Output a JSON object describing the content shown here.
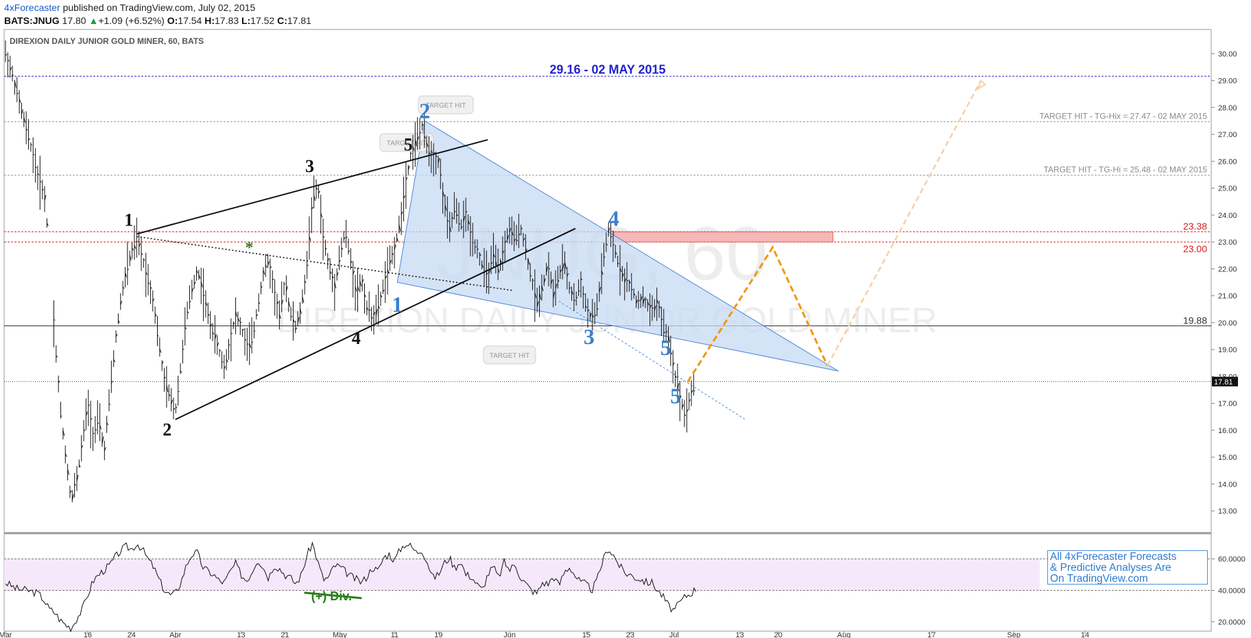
{
  "header": {
    "author": "4xForecaster",
    "published": "published on TradingView.com, July 02, 2015",
    "symbol": "BATS:JNUG",
    "last": "17.80",
    "change_arrow": "▲",
    "change": "+1.09 (+6.52%)",
    "o_label": "O:",
    "o": "17.54",
    "h_label": "H:",
    "h": "17.83",
    "l_label": "L:",
    "l": "17.52",
    "c_label": "C:",
    "c": "17.81"
  },
  "chart_title": "DIREXION DAILY JUNIOR GOLD MINER, 60, BATS",
  "watermark": {
    "big": "JNUG, 60",
    "sub": "DIREXION DAILY JUNIOR GOLD MINER"
  },
  "chart_data": [
    {
      "type": "line",
      "name": "price",
      "x_ticks": [
        {
          "label": "Mar",
          "day": 0
        },
        {
          "label": "16",
          "day": 15
        },
        {
          "label": "24",
          "day": 23
        },
        {
          "label": "Apr",
          "day": 31
        },
        {
          "label": "13",
          "day": 43
        },
        {
          "label": "21",
          "day": 51
        },
        {
          "label": "May",
          "day": 61
        },
        {
          "label": "11",
          "day": 71
        },
        {
          "label": "19",
          "day": 79
        },
        {
          "label": "Jun",
          "day": 92
        },
        {
          "label": "15",
          "day": 106
        },
        {
          "label": "23",
          "day": 114
        },
        {
          "label": "Jul",
          "day": 122
        },
        {
          "label": "13",
          "day": 134
        },
        {
          "label": "20",
          "day": 141
        },
        {
          "label": "Aug",
          "day": 153
        },
        {
          "label": "17",
          "day": 169
        },
        {
          "label": "Sep",
          "day": 184
        },
        {
          "label": "14",
          "day": 197
        }
      ],
      "ylim": [
        12.2,
        30.9
      ],
      "y_ticks": [
        "13.00",
        "14.00",
        "15.00",
        "16.00",
        "17.00",
        "18.00",
        "19.00",
        "20.00",
        "21.00",
        "22.00",
        "23.00",
        "24.00",
        "25.00",
        "26.00",
        "27.00",
        "28.00",
        "29.00",
        "30.00"
      ],
      "price_path": [
        [
          0,
          30.0
        ],
        [
          1,
          29.4
        ],
        [
          2,
          28.6
        ],
        [
          3,
          27.8
        ],
        [
          4,
          27.0
        ],
        [
          5,
          26.3
        ],
        [
          6,
          25.3
        ],
        [
          7,
          24.9
        ],
        [
          8,
          22.8
        ],
        [
          9,
          19.5
        ],
        [
          10,
          16.8
        ],
        [
          11,
          15.0
        ],
        [
          12,
          13.4
        ],
        [
          13,
          14.2
        ],
        [
          14,
          15.5
        ],
        [
          15,
          17.0
        ],
        [
          16,
          15.8
        ],
        [
          17,
          16.4
        ],
        [
          18,
          15.2
        ],
        [
          19,
          17.2
        ],
        [
          20,
          19.2
        ],
        [
          21,
          20.8
        ],
        [
          22,
          21.9
        ],
        [
          23,
          22.6
        ],
        [
          24,
          23.1
        ],
        [
          25,
          22.4
        ],
        [
          26,
          21.6
        ],
        [
          27,
          20.8
        ],
        [
          28,
          19.2
        ],
        [
          29,
          17.8
        ],
        [
          30,
          17.2
        ],
        [
          31,
          16.7
        ],
        [
          32,
          18.4
        ],
        [
          33,
          20.2
        ],
        [
          34,
          21.2
        ],
        [
          35,
          22.0
        ],
        [
          36,
          21.2
        ],
        [
          37,
          20.2
        ],
        [
          38,
          19.6
        ],
        [
          39,
          18.9
        ],
        [
          40,
          18.3
        ],
        [
          41,
          19.4
        ],
        [
          42,
          20.3
        ],
        [
          43,
          19.8
        ],
        [
          44,
          19.1
        ],
        [
          45,
          19.3
        ],
        [
          46,
          20.6
        ],
        [
          47,
          21.8
        ],
        [
          48,
          22.3
        ],
        [
          49,
          21.2
        ],
        [
          50,
          20.2
        ],
        [
          51,
          21.6
        ],
        [
          52,
          20.3
        ],
        [
          53,
          19.8
        ],
        [
          54,
          20.6
        ],
        [
          55,
          22.1
        ],
        [
          56,
          24.5
        ],
        [
          57,
          25.1
        ],
        [
          58,
          23.1
        ],
        [
          59,
          22.1
        ],
        [
          60,
          21.3
        ],
        [
          61,
          22.5
        ],
        [
          62,
          23.4
        ],
        [
          63,
          22.3
        ],
        [
          64,
          21.1
        ],
        [
          65,
          21.6
        ],
        [
          66,
          20.5
        ],
        [
          67,
          20.2
        ],
        [
          68,
          20.5
        ],
        [
          69,
          21.4
        ],
        [
          70,
          22.1
        ],
        [
          71,
          22.8
        ],
        [
          72,
          23.7
        ],
        [
          73,
          25.2
        ],
        [
          74,
          26.3
        ],
        [
          75,
          26.8
        ],
        [
          76,
          27.3
        ],
        [
          77,
          26.5
        ],
        [
          78,
          26.2
        ],
        [
          79,
          26.0
        ],
        [
          80,
          24.5
        ],
        [
          81,
          23.4
        ],
        [
          82,
          24.3
        ],
        [
          83,
          23.6
        ],
        [
          84,
          24.0
        ],
        [
          85,
          23.2
        ],
        [
          86,
          22.8
        ],
        [
          87,
          22.1
        ],
        [
          88,
          21.7
        ],
        [
          89,
          22.5
        ],
        [
          90,
          21.9
        ],
        [
          91,
          22.8
        ],
        [
          92,
          23.5
        ],
        [
          93,
          23.0
        ],
        [
          94,
          23.6
        ],
        [
          95,
          22.6
        ],
        [
          96,
          21.6
        ],
        [
          97,
          20.7
        ],
        [
          98,
          21.4
        ],
        [
          99,
          22.2
        ],
        [
          100,
          21.0
        ],
        [
          101,
          21.8
        ],
        [
          102,
          22.2
        ],
        [
          103,
          21.2
        ],
        [
          104,
          20.8
        ],
        [
          105,
          21.5
        ],
        [
          106,
          20.5
        ],
        [
          107,
          20.1
        ],
        [
          108,
          20.6
        ],
        [
          109,
          22.2
        ],
        [
          110,
          23.4
        ],
        [
          111,
          22.8
        ],
        [
          112,
          22.1
        ],
        [
          113,
          21.6
        ],
        [
          114,
          21.4
        ],
        [
          115,
          20.8
        ],
        [
          116,
          20.9
        ],
        [
          117,
          20.7
        ],
        [
          118,
          20.4
        ],
        [
          119,
          20.8
        ],
        [
          120,
          19.8
        ],
        [
          121,
          19.4
        ],
        [
          122,
          18.2
        ],
        [
          123,
          17.3
        ],
        [
          124,
          16.6
        ],
        [
          125,
          17.3
        ],
        [
          126,
          17.8
        ]
      ],
      "wave_labels_black": [
        {
          "t": "1",
          "day": 22.5,
          "price": 23.6
        },
        {
          "t": "2",
          "day": 29.5,
          "price": 15.8
        },
        {
          "t": "3",
          "day": 55.5,
          "price": 25.6
        },
        {
          "t": "4",
          "day": 64,
          "price": 19.2
        },
        {
          "t": "5",
          "day": 73.5,
          "price": 26.4
        },
        {
          "t": "*",
          "day": 44.5,
          "price": 22.6
        }
      ],
      "wave_labels_blue": [
        {
          "t": "2",
          "day": 76.5,
          "price": 27.6
        },
        {
          "t": "1",
          "day": 71.5,
          "price": 20.4
        },
        {
          "t": "4",
          "day": 111,
          "price": 23.6
        },
        {
          "t": "3",
          "day": 106.5,
          "price": 19.2
        },
        {
          "t": "5",
          "day": 120.5,
          "price": 18.8
        },
        {
          "t": "5",
          "day": 122.3,
          "price": 17.0
        }
      ],
      "levels": [
        {
          "price": 29.16,
          "color": "#2222cc",
          "label": "29.16 - 02 MAY 2015",
          "style": "dashed"
        },
        {
          "price": 27.47,
          "color": "#999999",
          "label": "TARGET HIT - TG-Hix = 27.47 - 02 MAY 2015",
          "style": "dashed"
        },
        {
          "price": 25.48,
          "color": "#999999",
          "label": "TARGET HIT - TG-Hi = 25.48 - 02 MAY 2015",
          "style": "dashed"
        },
        {
          "price": 23.38,
          "color": "#d62020",
          "label": "23.38",
          "style": "dashed"
        },
        {
          "price": 23.0,
          "color": "#d62020",
          "label": "23.00",
          "style": "dashed"
        },
        {
          "price": 19.88,
          "color": "#333333",
          "label": "19.88",
          "style": "solid"
        },
        {
          "price": 17.81,
          "color": "#333333",
          "label": "17.81",
          "style": "dotted"
        }
      ],
      "target_hit_label": "TARGET HIT"
    },
    {
      "type": "line",
      "name": "oscillator",
      "ylim": [
        14.0,
        76.0
      ],
      "y_ticks": [
        "20.0000",
        "40.0000",
        "60.0000"
      ],
      "upper_band": 60,
      "lower_band": 40,
      "annotation": "(+) Div.",
      "values": [
        [
          0,
          45
        ],
        [
          2,
          41
        ],
        [
          4,
          40
        ],
        [
          6,
          38
        ],
        [
          7,
          34
        ],
        [
          8,
          28
        ],
        [
          9,
          26
        ],
        [
          10,
          21
        ],
        [
          11,
          18
        ],
        [
          12,
          16
        ],
        [
          13,
          22
        ],
        [
          14,
          28
        ],
        [
          15,
          37
        ],
        [
          16,
          46
        ],
        [
          17,
          50
        ],
        [
          18,
          53
        ],
        [
          19,
          56
        ],
        [
          20,
          61
        ],
        [
          21,
          65
        ],
        [
          22,
          68
        ],
        [
          23,
          66
        ],
        [
          24,
          70
        ],
        [
          25,
          66
        ],
        [
          26,
          60
        ],
        [
          27,
          55
        ],
        [
          28,
          47
        ],
        [
          29,
          40
        ],
        [
          30,
          37
        ],
        [
          31,
          38
        ],
        [
          32,
          45
        ],
        [
          33,
          56
        ],
        [
          34,
          63
        ],
        [
          35,
          64
        ],
        [
          36,
          55
        ],
        [
          37,
          52
        ],
        [
          38,
          50
        ],
        [
          39,
          46
        ],
        [
          40,
          45
        ],
        [
          41,
          52
        ],
        [
          42,
          57
        ],
        [
          43,
          50
        ],
        [
          44,
          46
        ],
        [
          45,
          52
        ],
        [
          46,
          60
        ],
        [
          47,
          55
        ],
        [
          48,
          48
        ],
        [
          49,
          56
        ],
        [
          50,
          54
        ],
        [
          51,
          50
        ],
        [
          52,
          48
        ],
        [
          53,
          44
        ],
        [
          54,
          50
        ],
        [
          55,
          62
        ],
        [
          56,
          70
        ],
        [
          57,
          58
        ],
        [
          58,
          47
        ],
        [
          59,
          48
        ],
        [
          60,
          56
        ],
        [
          61,
          55
        ],
        [
          62,
          52
        ],
        [
          63,
          49
        ],
        [
          64,
          47
        ],
        [
          65,
          45
        ],
        [
          66,
          49
        ],
        [
          67,
          55
        ],
        [
          68,
          52
        ],
        [
          69,
          61
        ],
        [
          70,
          63
        ],
        [
          71,
          59
        ],
        [
          72,
          66
        ],
        [
          73,
          70
        ],
        [
          74,
          68
        ],
        [
          75,
          64
        ],
        [
          76,
          66
        ],
        [
          77,
          58
        ],
        [
          78,
          48
        ],
        [
          79,
          50
        ],
        [
          80,
          57
        ],
        [
          81,
          61
        ],
        [
          82,
          54
        ],
        [
          83,
          59
        ],
        [
          84,
          50
        ],
        [
          85,
          49
        ],
        [
          86,
          44
        ],
        [
          87,
          40
        ],
        [
          88,
          50
        ],
        [
          89,
          55
        ],
        [
          90,
          48
        ],
        [
          91,
          58
        ],
        [
          92,
          53
        ],
        [
          93,
          57
        ],
        [
          94,
          48
        ],
        [
          95,
          44
        ],
        [
          96,
          40
        ],
        [
          97,
          38
        ],
        [
          98,
          45
        ],
        [
          99,
          44
        ],
        [
          100,
          49
        ],
        [
          101,
          43
        ],
        [
          102,
          52
        ],
        [
          103,
          55
        ],
        [
          104,
          49
        ],
        [
          105,
          45
        ],
        [
          106,
          44
        ],
        [
          107,
          40
        ],
        [
          108,
          47
        ],
        [
          109,
          59
        ],
        [
          110,
          67
        ],
        [
          111,
          62
        ],
        [
          112,
          56
        ],
        [
          113,
          51
        ],
        [
          114,
          50
        ],
        [
          115,
          48
        ],
        [
          116,
          47
        ],
        [
          117,
          45
        ],
        [
          118,
          45
        ],
        [
          119,
          40
        ],
        [
          120,
          36
        ],
        [
          121,
          30
        ],
        [
          122,
          27
        ],
        [
          123,
          32
        ],
        [
          124,
          36
        ],
        [
          125,
          38
        ],
        [
          126,
          41
        ]
      ]
    }
  ],
  "promo": [
    "All 4xForecaster Forecasts",
    "& Predictive Analyses Are",
    "On TradingView.com"
  ],
  "colors": {
    "blue_wave": "#3a7fd0",
    "triangle_fill": "#c5d9f3",
    "projection": "#f2960e",
    "projection_faint": "#f7cfa8",
    "zone_fill": "#f5b7b7",
    "osc_band": "#f6e8fb"
  }
}
